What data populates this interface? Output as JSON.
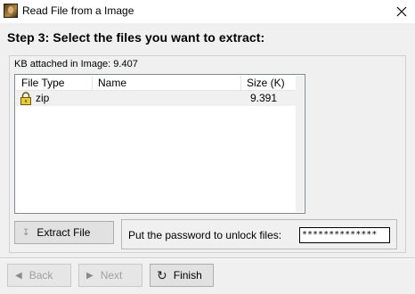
{
  "window": {
    "title": "Read File from a Image",
    "close_icon": "close-icon"
  },
  "step": {
    "header": "Step 3: Select the files you want to extract:"
  },
  "attachment": {
    "kb_label": "KB attached in Image: 9.407"
  },
  "file_list": {
    "columns": [
      "File Type",
      "Name",
      "Size (K)"
    ],
    "rows": [
      {
        "type": "zip",
        "name": "",
        "size": "9.391",
        "icon": "lock-icon"
      }
    ]
  },
  "actions": {
    "extract_label": "Extract File",
    "password_label": "Put the password to unlock files:",
    "password_value": "**************"
  },
  "footer": {
    "back_label": "Back",
    "next_label": "Next",
    "finish_label": "Finish"
  }
}
